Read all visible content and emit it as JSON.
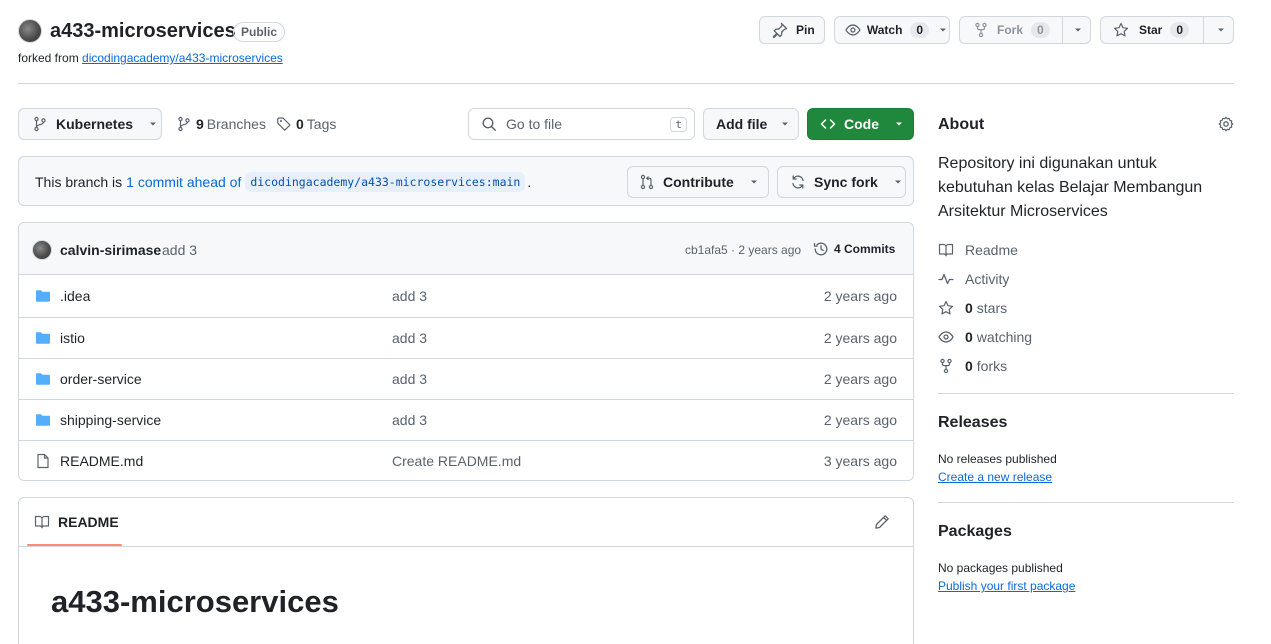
{
  "repo": {
    "name": "a433-microservices",
    "visibility": "Public",
    "forked_prefix": "forked from",
    "forked_from": "dicodingacademy/a433-microservices"
  },
  "actions": {
    "pin": "Pin",
    "watch": "Watch",
    "watch_count": "0",
    "fork": "Fork",
    "fork_count": "0",
    "star": "Star",
    "star_count": "0"
  },
  "toolbar": {
    "branch": "Kubernetes",
    "branches_count": "9",
    "branches_label": "Branches",
    "tags_count": "0",
    "tags_label": "Tags",
    "search_placeholder": "Go to file",
    "search_shortcut": "t",
    "add_file": "Add file",
    "code": "Code"
  },
  "branch_info": {
    "prefix": "This branch is",
    "ahead_link": "1 commit ahead of",
    "ref": "dicodingacademy/a433-microservices:main",
    "suffix": ".",
    "contribute": "Contribute",
    "sync_fork": "Sync fork"
  },
  "latest_commit": {
    "author": "calvin-sirimase",
    "message": "add 3",
    "sha_time": "cb1afa5 · 2 years ago",
    "commits_label": "4 Commits"
  },
  "files": [
    {
      "name": ".idea",
      "type": "folder",
      "message": "add 3",
      "age": "2 years ago"
    },
    {
      "name": "istio",
      "type": "folder",
      "message": "add 3",
      "age": "2 years ago"
    },
    {
      "name": "order-service",
      "type": "folder",
      "message": "add 3",
      "age": "2 years ago"
    },
    {
      "name": "shipping-service",
      "type": "folder",
      "message": "add 3",
      "age": "2 years ago"
    },
    {
      "name": "README.md",
      "type": "file",
      "message": "Create README.md",
      "age": "3 years ago"
    }
  ],
  "readme": {
    "tab_label": "README",
    "heading": "a433-microservices"
  },
  "about": {
    "title": "About",
    "description": "Repository ini digunakan untuk kebutuhan kelas Belajar Membangun Arsitektur Microservices",
    "readme": "Readme",
    "activity": "Activity",
    "stars_count": "0",
    "stars_label": "stars",
    "watching_count": "0",
    "watching_label": "watching",
    "forks_count": "0",
    "forks_label": "forks"
  },
  "releases": {
    "title": "Releases",
    "empty": "No releases published",
    "link": "Create a new release"
  },
  "packages": {
    "title": "Packages",
    "empty": "No packages published",
    "link": "Publish your first package"
  },
  "colors": {
    "accent_link": "#0969da",
    "code_button": "#1f883d",
    "folder_icon": "#54aeff",
    "readme_underline": "#fd8c73"
  }
}
